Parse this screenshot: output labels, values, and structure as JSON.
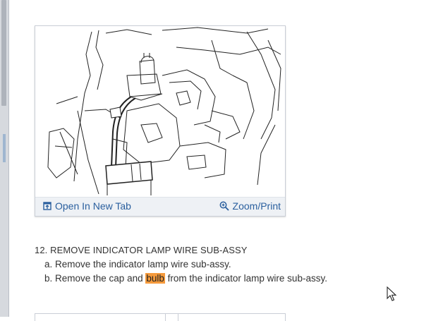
{
  "figure": {
    "open_label": "Open In New Tab",
    "zoom_label": "Zoom/Print"
  },
  "procedure": {
    "step_title": "12. REMOVE INDICATOR LAMP WIRE SUB-ASSY",
    "sub_a": "a. Remove the indicator lamp wire sub-assy.",
    "sub_b_pre": "b. Remove the cap and ",
    "sub_b_highlight": "bulb",
    "sub_b_post": " from the indicator lamp wire sub-assy."
  },
  "colors": {
    "link": "#2a5f9e",
    "highlight": "#f59a3c"
  }
}
